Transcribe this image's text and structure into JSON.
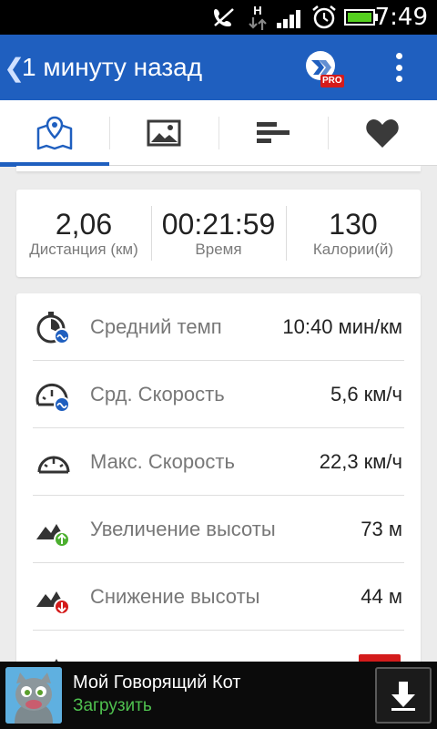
{
  "status_bar": {
    "time": "7:49",
    "network_label": "H",
    "icons": [
      "mute-icon",
      "network-h-icon",
      "signal-icon",
      "alarm-icon",
      "battery-icon"
    ]
  },
  "action_bar": {
    "title": "1 минуту назад",
    "back_icon": "chevron-left-icon",
    "pro_badge": "PRO",
    "menu_icon": "more-vertical-icon",
    "color": "#1f5fbf"
  },
  "tabs": [
    {
      "icon": "map-pin-icon",
      "active": true
    },
    {
      "icon": "image-icon",
      "active": false
    },
    {
      "icon": "bar-list-icon",
      "active": false
    },
    {
      "icon": "heart-icon",
      "active": false
    }
  ],
  "summary": [
    {
      "value": "2,06",
      "label": "Дистанция (км)"
    },
    {
      "value": "00:21:59",
      "label": "Время"
    },
    {
      "value": "130",
      "label": "Калории(й)"
    }
  ],
  "stats": [
    {
      "icon": "stopwatch-pace-icon",
      "label": "Средний темп",
      "value": "10:40 мин/км"
    },
    {
      "icon": "speedometer-avg-icon",
      "label": "Срд. Скорость",
      "value": "5,6 км/ч"
    },
    {
      "icon": "speedometer-max-icon",
      "label": "Макс. Скорость",
      "value": "22,3 км/ч"
    },
    {
      "icon": "elevation-gain-icon",
      "label": "Увеличение высоты",
      "value": "73 м"
    },
    {
      "icon": "elevation-loss-icon",
      "label": "Снижение высоты",
      "value": "44 м"
    }
  ],
  "ad": {
    "title": "Мой Говорящий Кот",
    "subtitle": "Загрузить",
    "download_icon": "download-arrow-icon"
  }
}
